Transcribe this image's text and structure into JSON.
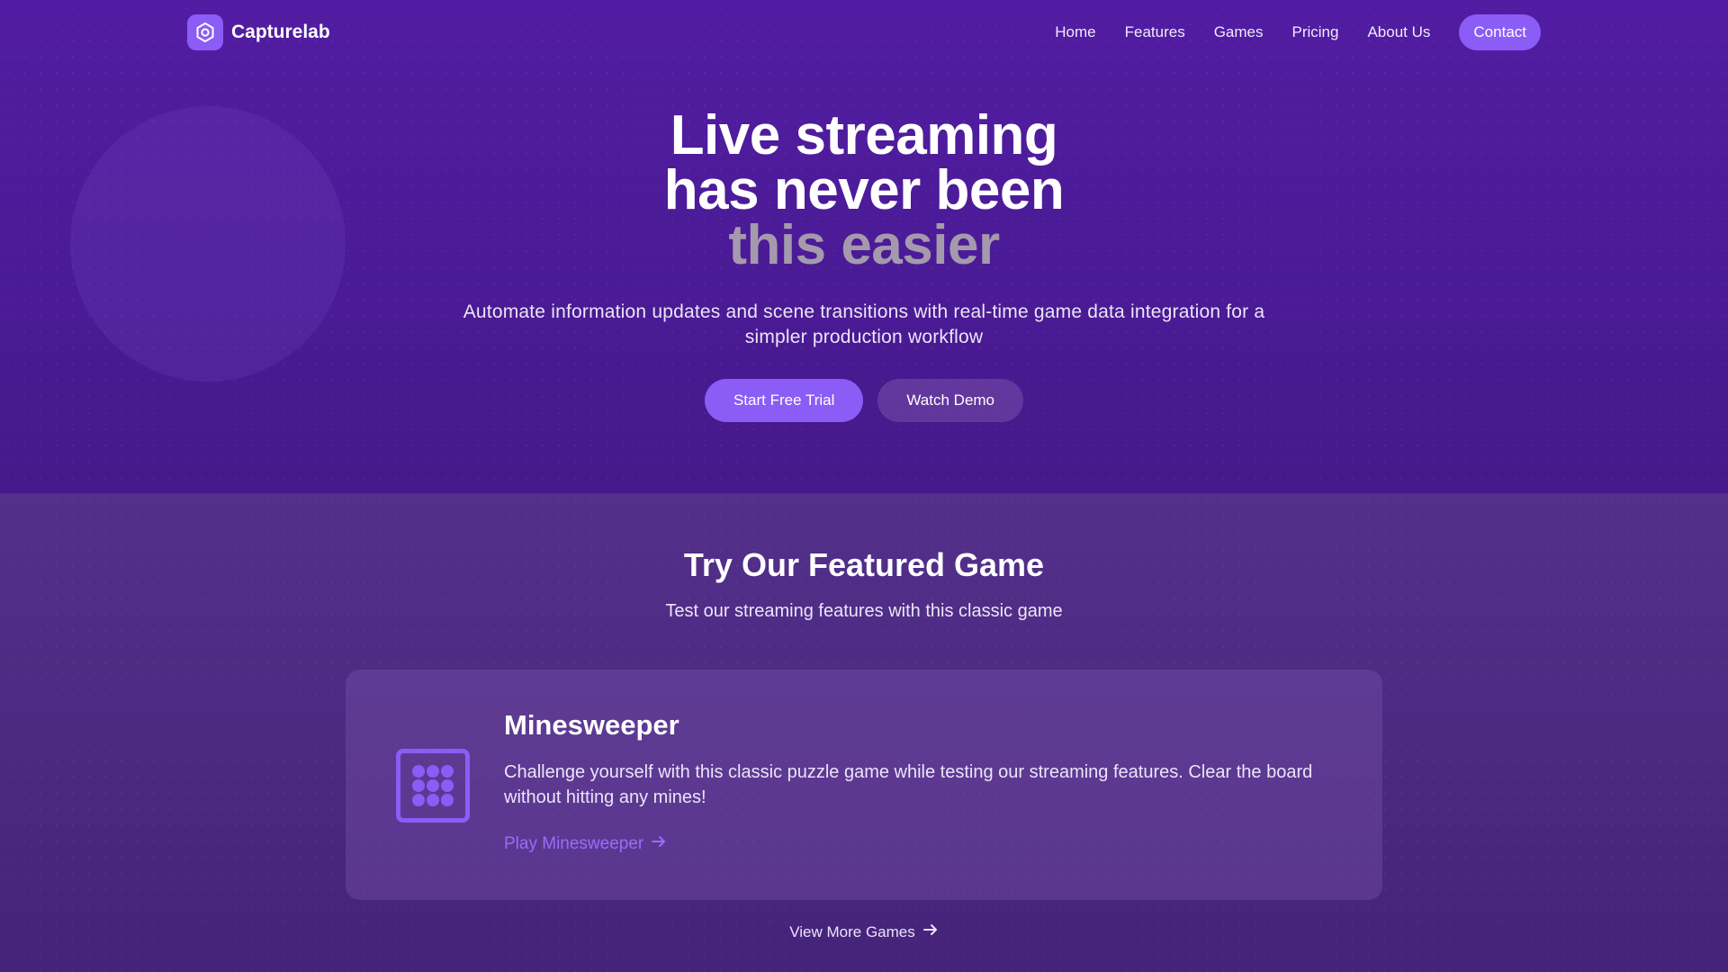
{
  "brand": {
    "name": "Capturelab",
    "logo_icon": "hexagon-lens-icon",
    "accent_color": "#8b5cf6"
  },
  "nav": {
    "links": [
      "Home",
      "Features",
      "Games",
      "Pricing",
      "About Us"
    ],
    "contact_label": "Contact"
  },
  "hero": {
    "title_line1": "Live streaming",
    "title_line2": "has never been",
    "title_line3": "this easier",
    "subtitle": "Automate information updates and scene transitions with real-time game data integration for a simpler production workflow",
    "primary_cta": "Start Free Trial",
    "secondary_cta": "Watch Demo"
  },
  "featured": {
    "title": "Try Our Featured Game",
    "subtitle": "Test our streaming features with this classic game",
    "game": {
      "name": "Minesweeper",
      "icon": "grid-icon",
      "description": "Challenge yourself with this classic puzzle game while testing our streaming features. Clear the board without hitting any mines!",
      "link_label": "Play Minesweeper",
      "link_icon": "arrow-right-icon"
    },
    "more_label": "View More Games",
    "more_icon": "arrow-right-icon"
  },
  "colors": {
    "background": "#4a1b95",
    "section_background": "#4c2a82",
    "accent": "#8b5cf6",
    "muted_title": "#a59aad"
  }
}
